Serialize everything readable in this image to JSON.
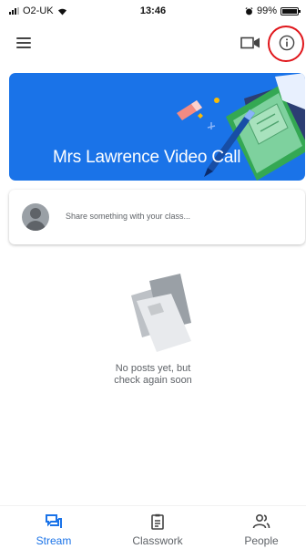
{
  "status_bar": {
    "carrier": "O2-UK",
    "time": "13:46",
    "battery": "99%",
    "battery_level": 0.99
  },
  "app_bar": {
    "menu_icon": "hamburger-menu-icon",
    "video_icon": "video-camera-icon",
    "info_icon": "info-icon"
  },
  "banner": {
    "title": "Mrs Lawrence Video Call",
    "color": "#1a73e8"
  },
  "share": {
    "placeholder": "Share something with your class..."
  },
  "empty_state": {
    "line1": "No posts yet, but",
    "line2": "check again soon"
  },
  "bottom_nav": {
    "items": [
      {
        "label": "Stream",
        "icon": "stream-icon",
        "active": true
      },
      {
        "label": "Classwork",
        "icon": "classwork-icon",
        "active": false
      },
      {
        "label": "People",
        "icon": "people-icon",
        "active": false
      }
    ]
  },
  "colors": {
    "accent": "#1a73e8",
    "highlight_ring": "#e0161b",
    "text_secondary": "#5f6368"
  }
}
